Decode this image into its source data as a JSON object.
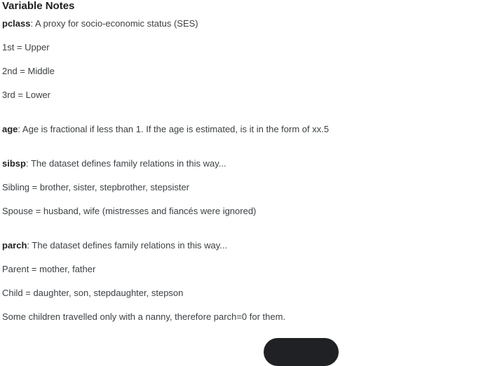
{
  "title": "Variable Notes",
  "notes": [
    {
      "term": "pclass",
      "text": ": A proxy for socio-economic status (SES)"
    },
    {
      "text": "1st = Upper"
    },
    {
      "text": "2nd = Middle"
    },
    {
      "text": "3rd = Lower"
    },
    {
      "term": "age",
      "text": ": Age is fractional if less than 1. If the age is estimated, is it in the form of xx.5"
    },
    {
      "term": "sibsp",
      "text": ": The dataset defines family relations in this way..."
    },
    {
      "text": "Sibling = brother, sister, stepbrother, stepsister"
    },
    {
      "text": "Spouse = husband, wife (mistresses and fiancés were ignored)"
    },
    {
      "term": "parch",
      "text": ": The dataset defines family relations in this way..."
    },
    {
      "text": "Parent = mother, father"
    },
    {
      "text": "Child = daughter, son, stepdaughter, stepson"
    },
    {
      "text": "Some children travelled only with a nanny, therefore parch=0 for them."
    }
  ]
}
